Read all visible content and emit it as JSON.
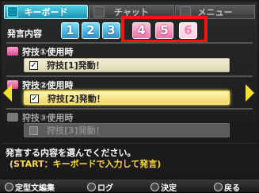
{
  "tabs": [
    {
      "label": "キーボード"
    },
    {
      "label": "チャット"
    },
    {
      "label": "メニュー"
    }
  ],
  "speech": {
    "label": "発言内容",
    "pages": [
      "1",
      "2",
      "3",
      "4",
      "5",
      "6"
    ],
    "selected_page": "6"
  },
  "items": [
    {
      "title": "狩技①使用時",
      "text": "狩技[1]発動！",
      "checked": true,
      "state": "normal"
    },
    {
      "title": "狩技②使用時",
      "text": "狩技[2]発動！",
      "checked": true,
      "state": "selected"
    },
    {
      "title": "狩技③使用時",
      "text": "狩技[3]発動！",
      "checked": false,
      "state": "disabled"
    }
  ],
  "description": {
    "line1": "発言する内容を選んでください。",
    "line2": "(START：キーボードで入力して発言)"
  },
  "footer": {
    "template": "定型文編集",
    "log": "ログ",
    "confirm": "決定",
    "back": "戻る"
  },
  "icons": {
    "left_arrow": "left-arrow-icon",
    "right_arrow": "right-arrow-icon",
    "checkbox": "checkbox-icon"
  },
  "colors": {
    "active_tab": "#1c8fb0",
    "page_blue": "#2d8ec9",
    "page_pink": "#ef6fa8",
    "highlight_outline": "#ff1212",
    "selected_field": "#eed76d",
    "arrow": "#f7e02f",
    "hint_text": "#ffd93d"
  }
}
